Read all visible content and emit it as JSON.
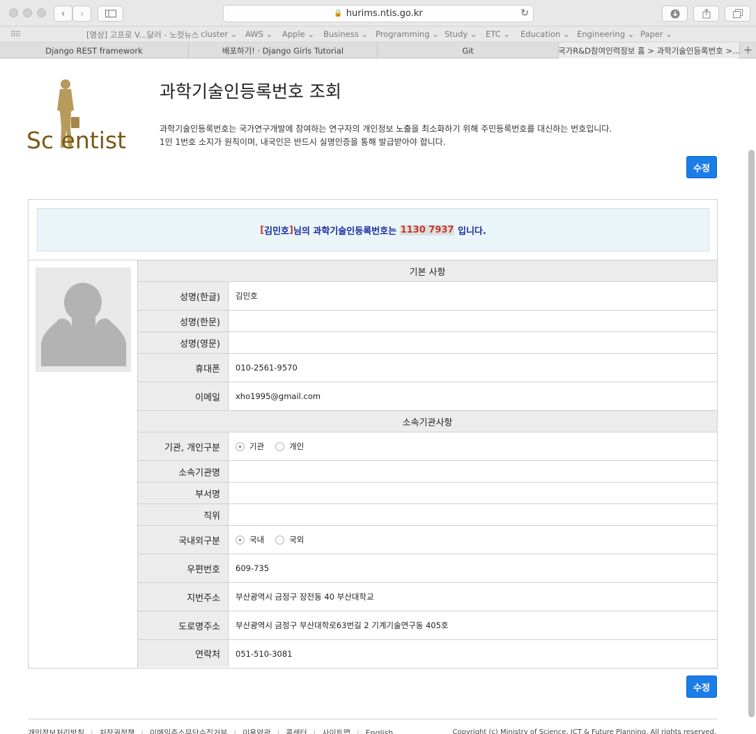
{
  "browser": {
    "url": "hurims.ntis.go.kr",
    "bookmarks": [
      {
        "label": "[영상] 고프로 V...달러 - 노컷뉴스"
      },
      {
        "label": "cluster ⌄"
      },
      {
        "label": "AWS ⌄"
      },
      {
        "label": "Apple ⌄"
      },
      {
        "label": "Business ⌄"
      },
      {
        "label": "Programming ⌄"
      },
      {
        "label": "Study ⌄"
      },
      {
        "label": "ETC ⌄"
      },
      {
        "label": "Education ⌄"
      },
      {
        "label": "Engineering ⌄"
      },
      {
        "label": "Paper ⌄"
      }
    ],
    "tabs": [
      {
        "label": "Django REST framework"
      },
      {
        "label": "배포하기! · Django Girls Tutorial"
      },
      {
        "label": "Git"
      },
      {
        "label": "국가R&D참여인력정보 홈 > 과학기술인등록번호 >..."
      }
    ],
    "new_tab": "+"
  },
  "header": {
    "logo_text": "Sc  entist",
    "title": "과학기술인등록번호 조회",
    "desc_line1": "과학기술인등록번호는 국가연구개발에 참여하는 연구자의 개인정보 노출을 최소화하기 위해 주민등록번호를 대신하는 번호입니다.",
    "desc_line2": "1인 1번호 소지가 원칙이며, 내국인은 반드시 실명인증을 통해 발급받아야 합니다.",
    "edit_button": "수정"
  },
  "notice": {
    "bracket_open": "[",
    "user_name": "김민호",
    "bracket_close": "]",
    "mid_text": "님의 과학기술인등록번호는 ",
    "number": "1130 7937",
    "end_text": " 입니다."
  },
  "basic": {
    "section_title": "기본 사항",
    "name_kr_label": "성명(한글)",
    "name_kr_value": "김민호",
    "name_cn_label": "성명(한문)",
    "name_cn_value": "",
    "name_en_label": "성명(영문)",
    "name_en_value": "",
    "phone_label": "휴대폰",
    "phone_value": "010-2561-9570",
    "email_label": "이메일",
    "email_value": "xho1995@gmail.com"
  },
  "affiliation": {
    "section_title": "소속기관사항",
    "type_label": "기관, 개인구분",
    "type_options": [
      "기관",
      "개인"
    ],
    "type_selected": "기관",
    "org_label": "소속기관명",
    "org_value": "",
    "dept_label": "부서명",
    "dept_value": "",
    "position_label": "직위",
    "position_value": "",
    "domestic_label": "국내외구분",
    "domestic_options": [
      "국내",
      "국외"
    ],
    "domestic_selected": "국내",
    "zip_label": "우편번호",
    "zip_value": "609-735",
    "lot_addr_label": "지번주소",
    "lot_addr_value": "부산광역시 금정구 장전동 40 부산대학교",
    "road_addr_label": "도로명주소",
    "road_addr_value": "부산광역시 금정구 부산대학로63번길 2 기계기술연구동 405호",
    "contact_label": "연락처",
    "contact_value": "051-510-3081"
  },
  "bottom_edit_button": "수정",
  "footer": {
    "links": [
      "개인정보처리방침",
      "저작권정책",
      "이메일주소무단수집거부",
      "이용약관",
      "콜센터",
      "사이트맵",
      "English"
    ],
    "copyright": "Copyright (c) Ministry of Science, ICT & Future Planning. All rights reserved."
  }
}
